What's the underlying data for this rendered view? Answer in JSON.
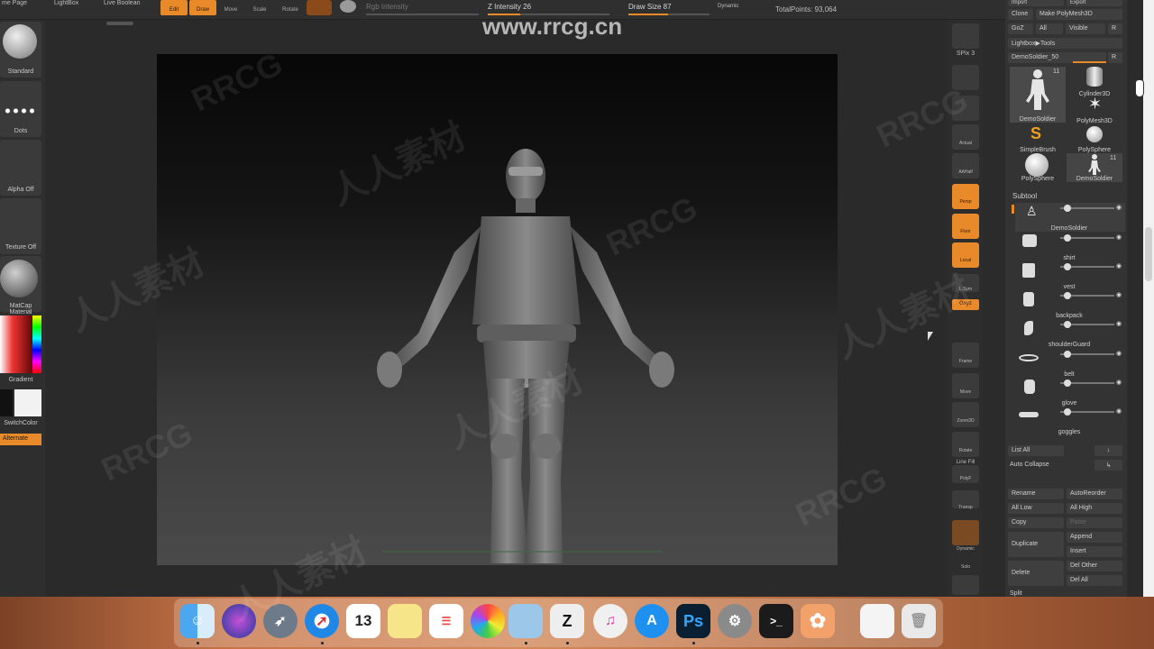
{
  "watermark": {
    "url": "www.rrcg.cn",
    "text": "RRCG",
    "cn": "人人素材"
  },
  "topbar": {
    "home_page": "me Page",
    "lightbox": "LightBox",
    "live_boolean": "Live Boolean",
    "edit": "Edit",
    "draw": "Draw",
    "move": "Move",
    "scale": "Scale",
    "rotate": "Rotate",
    "rgb_intensity": "Rgb Intensity",
    "z_intensity": "Z Intensity 26",
    "draw_size": "Draw Size 87",
    "dynamic": "Dynamic",
    "total_points": "TotalPoints: 93,064"
  },
  "left_shelf": {
    "brush": "Standard",
    "stroke": "Dots",
    "alpha": "Alpha Off",
    "texture": "Texture Off",
    "material": "MatCap Material",
    "gradient": "Gradient",
    "switch_color": "SwitchColor",
    "alternate": "Alternate"
  },
  "right_shelf": {
    "bpr": "BPR",
    "spix": "SPix 3",
    "scroll": "Scroll",
    "zoom": "Zoom",
    "actual": "Actual",
    "aahalf": "AAHalf",
    "persp": "Persp",
    "floor": "Floor",
    "local": "Local",
    "lsym": "L.Sym",
    "gxyz": "Gxyz",
    "frame": "Frame",
    "move": "Move",
    "zoom3d": "Zoom3D",
    "rotate": "Rotate",
    "line_fill": "Line Fill",
    "polyf": "PolyF",
    "transp": "Transp",
    "dynamic": "Dynamic",
    "solo": "Solo",
    "xpose": "Xpose"
  },
  "tool_panel": {
    "import": "Import",
    "export": "Export",
    "clone": "Clone",
    "make_polymesh": "Make PolyMesh3D",
    "goz": "GoZ",
    "all": "All",
    "visible": "Visible",
    "r": "R",
    "lightbox_tools": "Lightbox▶Tools",
    "current_tool": "DemoSoldier_50",
    "tools": [
      "DemoSoldier",
      "Cylinder3D",
      "PolyMesh3D",
      "SimpleBrush",
      "PolySphere",
      "PolySphere",
      "DemoSoldier"
    ],
    "tool_badges": [
      "11",
      "11"
    ],
    "subtool_header": "Subtool",
    "subtools": [
      "DemoSoldier",
      "shirt",
      "vest",
      "backpack",
      "shoulderGuard",
      "belt",
      "glove",
      "goggles"
    ],
    "list_all": "List All",
    "auto_collapse": "Auto Collapse",
    "rename": "Rename",
    "auto_reorder": "AutoReorder",
    "all_low": "All Low",
    "all_high": "All High",
    "copy": "Copy",
    "paste": "Paste",
    "duplicate": "Duplicate",
    "append": "Append",
    "insert": "Insert",
    "delete": "Delete",
    "del_other": "Del Other",
    "del_all": "Del All",
    "split": "Split"
  },
  "dock": {
    "icons": [
      "finder-icon",
      "siri-icon",
      "launchpad-icon",
      "safari-icon",
      "calendar-icon",
      "notes-icon",
      "reminders-icon",
      "photos-icon",
      "preview-icon",
      "zbrush-icon",
      "itunes-icon",
      "app-store-icon",
      "photoshop-icon",
      "system-preferences-icon",
      "terminal-icon",
      "zbrush-flower-icon",
      "documents-icon",
      "trash-icon"
    ],
    "calendar_day": "13",
    "photoshop_label": "Ps"
  },
  "colors": {
    "accent": "#e8892a"
  }
}
